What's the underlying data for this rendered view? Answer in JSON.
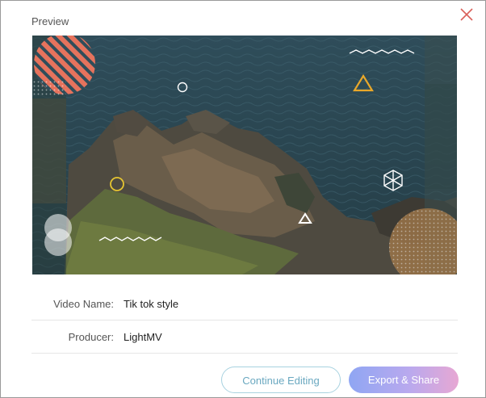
{
  "dialog": {
    "title": "Preview"
  },
  "preview": {
    "description_icons": [
      "close-icon"
    ]
  },
  "form": {
    "video_name_label": "Video Name:",
    "video_name_value": "Tik tok style",
    "producer_label": "Producer:",
    "producer_value": "LightMV"
  },
  "buttons": {
    "continue_label": "Continue Editing",
    "export_label": "Export & Share"
  },
  "colors": {
    "continue_border": "#a8d2e0",
    "continue_text": "#6aa8c0",
    "export_gradient_start": "#8fa6f3",
    "export_gradient_end": "#e7a7d3",
    "close_icon": "#d9605a"
  }
}
